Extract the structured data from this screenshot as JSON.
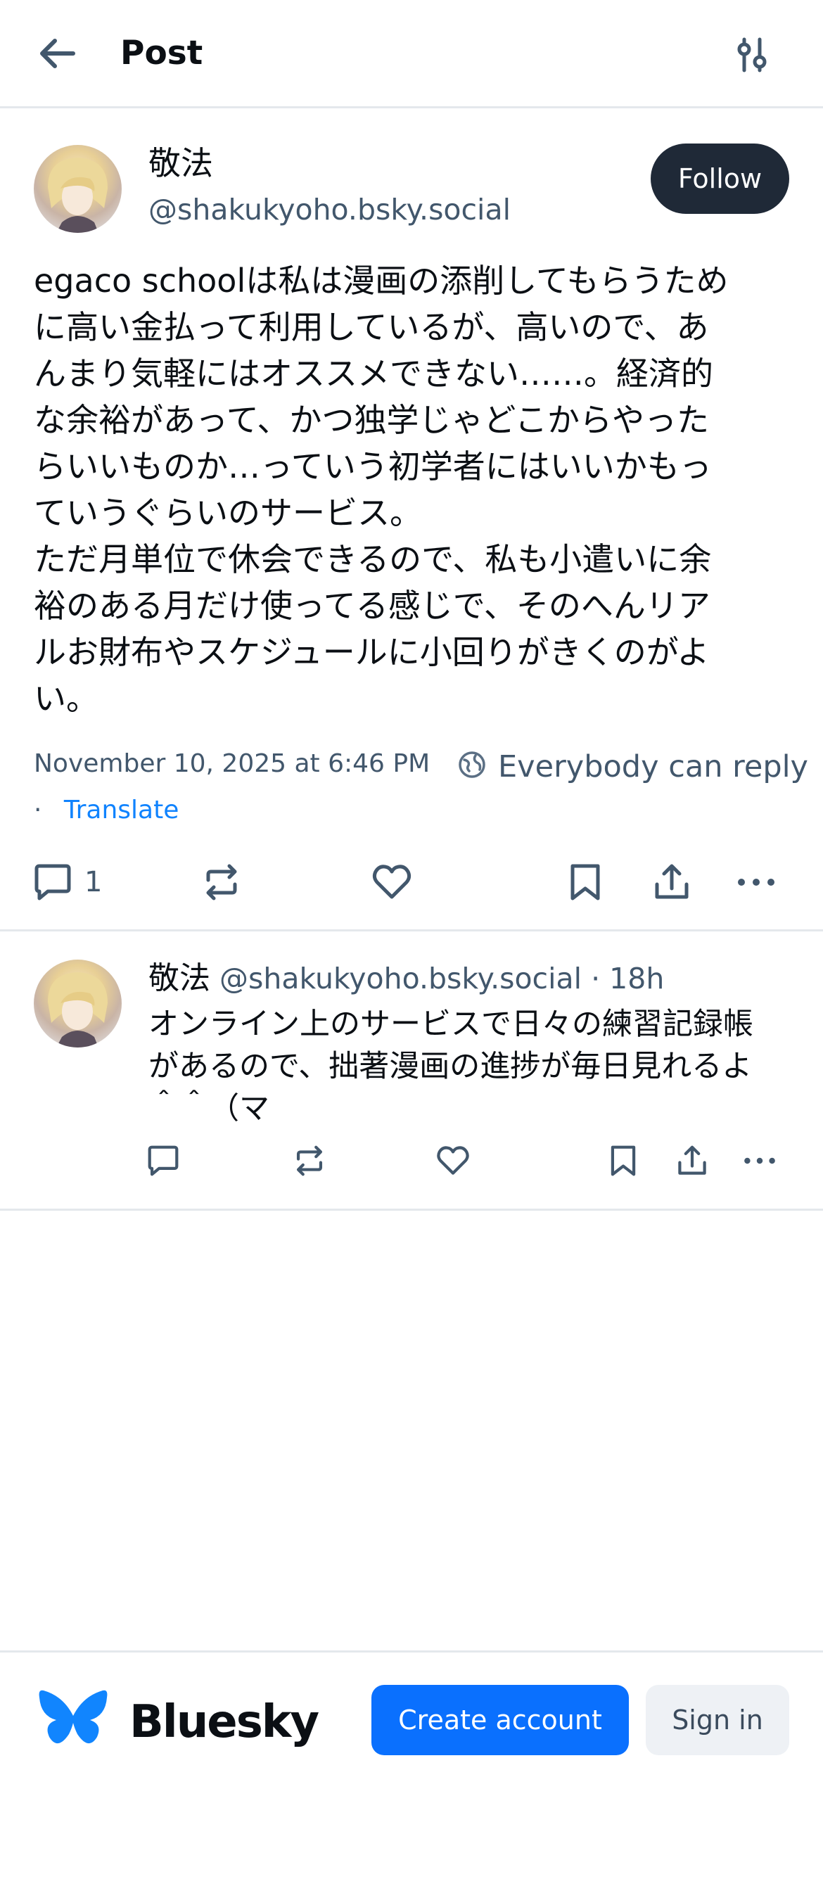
{
  "header": {
    "title": "Post",
    "back_icon": "arrow-left-icon",
    "settings_icon": "sliders-icon"
  },
  "post": {
    "author_name": "敬法",
    "author_handle": "@shakukyoho.bsky.social",
    "follow_label": "Follow",
    "text": "egaco schoolは私は漫画の添削してもらうため\nに高い金払って利用しているが、高いので、あ\nんまり気軽にはオススメできない……。経済的\nな余裕があって、かつ独学じゃどこからやった\nらいいものか…っていう初学者にはいいかもっ\nていうぐらいのサービス。\nただ月単位で休会できるので、私も小遣いに余\n裕のある月だけ使ってる感じで、そのへんリア\nルお財布やスケジュールに小回りがきくのがよ\nい。",
    "date": "November 10, 2025 at 6:46 PM",
    "reply_setting": "Everybody can reply",
    "separator": "·",
    "translate": "Translate",
    "reply_count": "1"
  },
  "reply": {
    "author_name": "敬法",
    "author_handle": "@shakukyoho.bsky.social",
    "separator": "·",
    "time": "18h",
    "text": "オンライン上のサービスで日々の練習記録帳\nがあるので、拙著漫画の進捗が毎日見れるよ\n＾＾（マ"
  },
  "bottom_bar": {
    "brand": "Bluesky",
    "create_account": "Create account",
    "sign_in": "Sign in"
  },
  "colors": {
    "accent": "#0a70fe",
    "link": "#1083fe",
    "muted": "#42576c",
    "follow_bg": "#1f2937"
  }
}
